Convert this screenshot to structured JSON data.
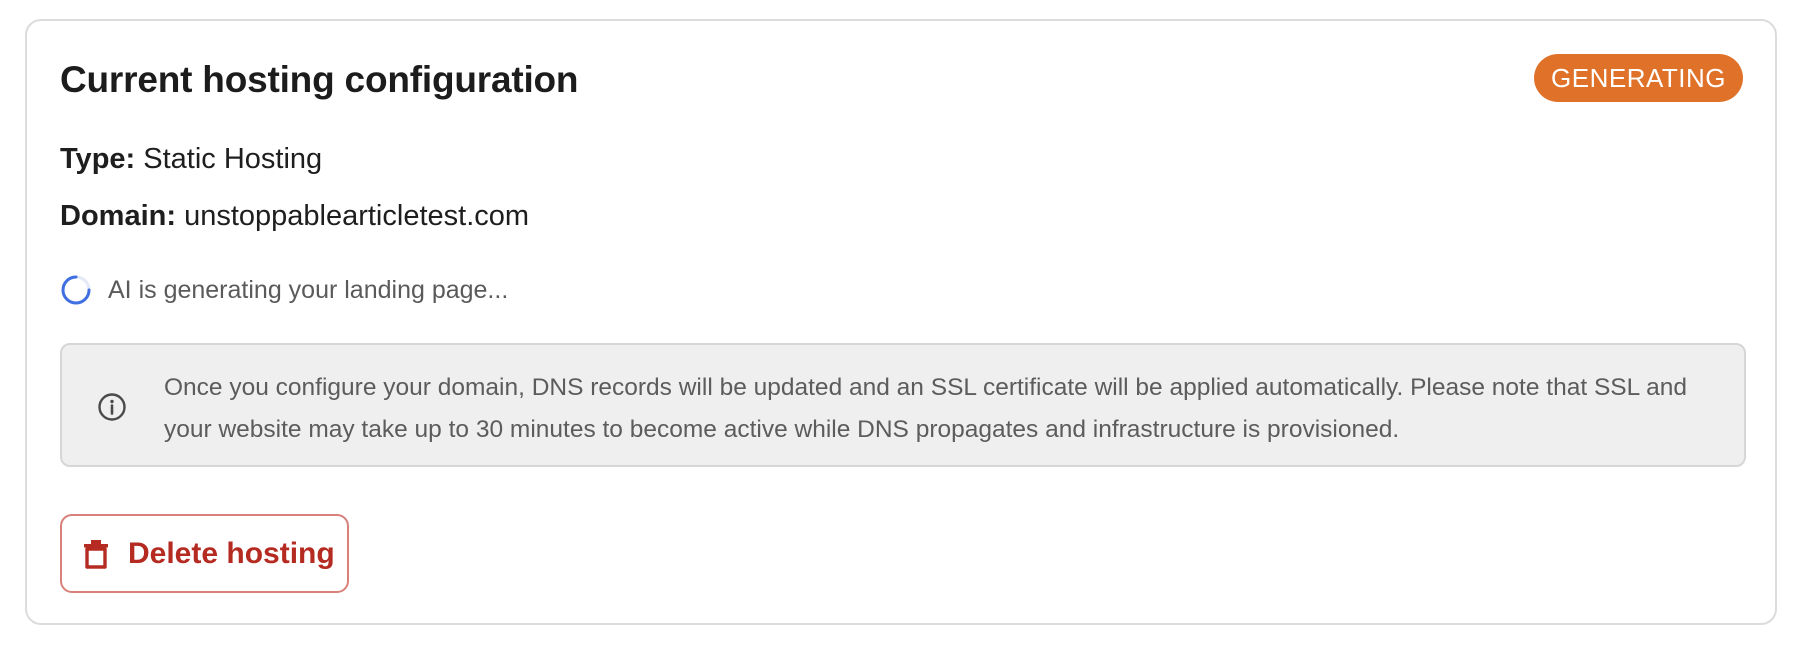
{
  "card": {
    "title": "Current hosting configuration",
    "status_badge": "GENERATING"
  },
  "fields": {
    "type_label": "Type:",
    "type_value": "Static Hosting",
    "domain_label": "Domain:",
    "domain_value": "unstoppablearticletest.com"
  },
  "progress": {
    "text": "AI is generating your landing page..."
  },
  "notice": {
    "icon": "info-icon",
    "text": "Once you configure your domain, DNS records will be updated and an SSL certificate will be applied automatically. Please note that SSL and your website may take up to 30 minutes to become active while DNS propagates and infrastructure is provisioned."
  },
  "actions": {
    "delete_label": "Delete hosting",
    "delete_icon": "trash-icon"
  },
  "colors": {
    "badge": "#e07129",
    "danger": "#b52b22",
    "spinner": "#3f6fe0"
  }
}
